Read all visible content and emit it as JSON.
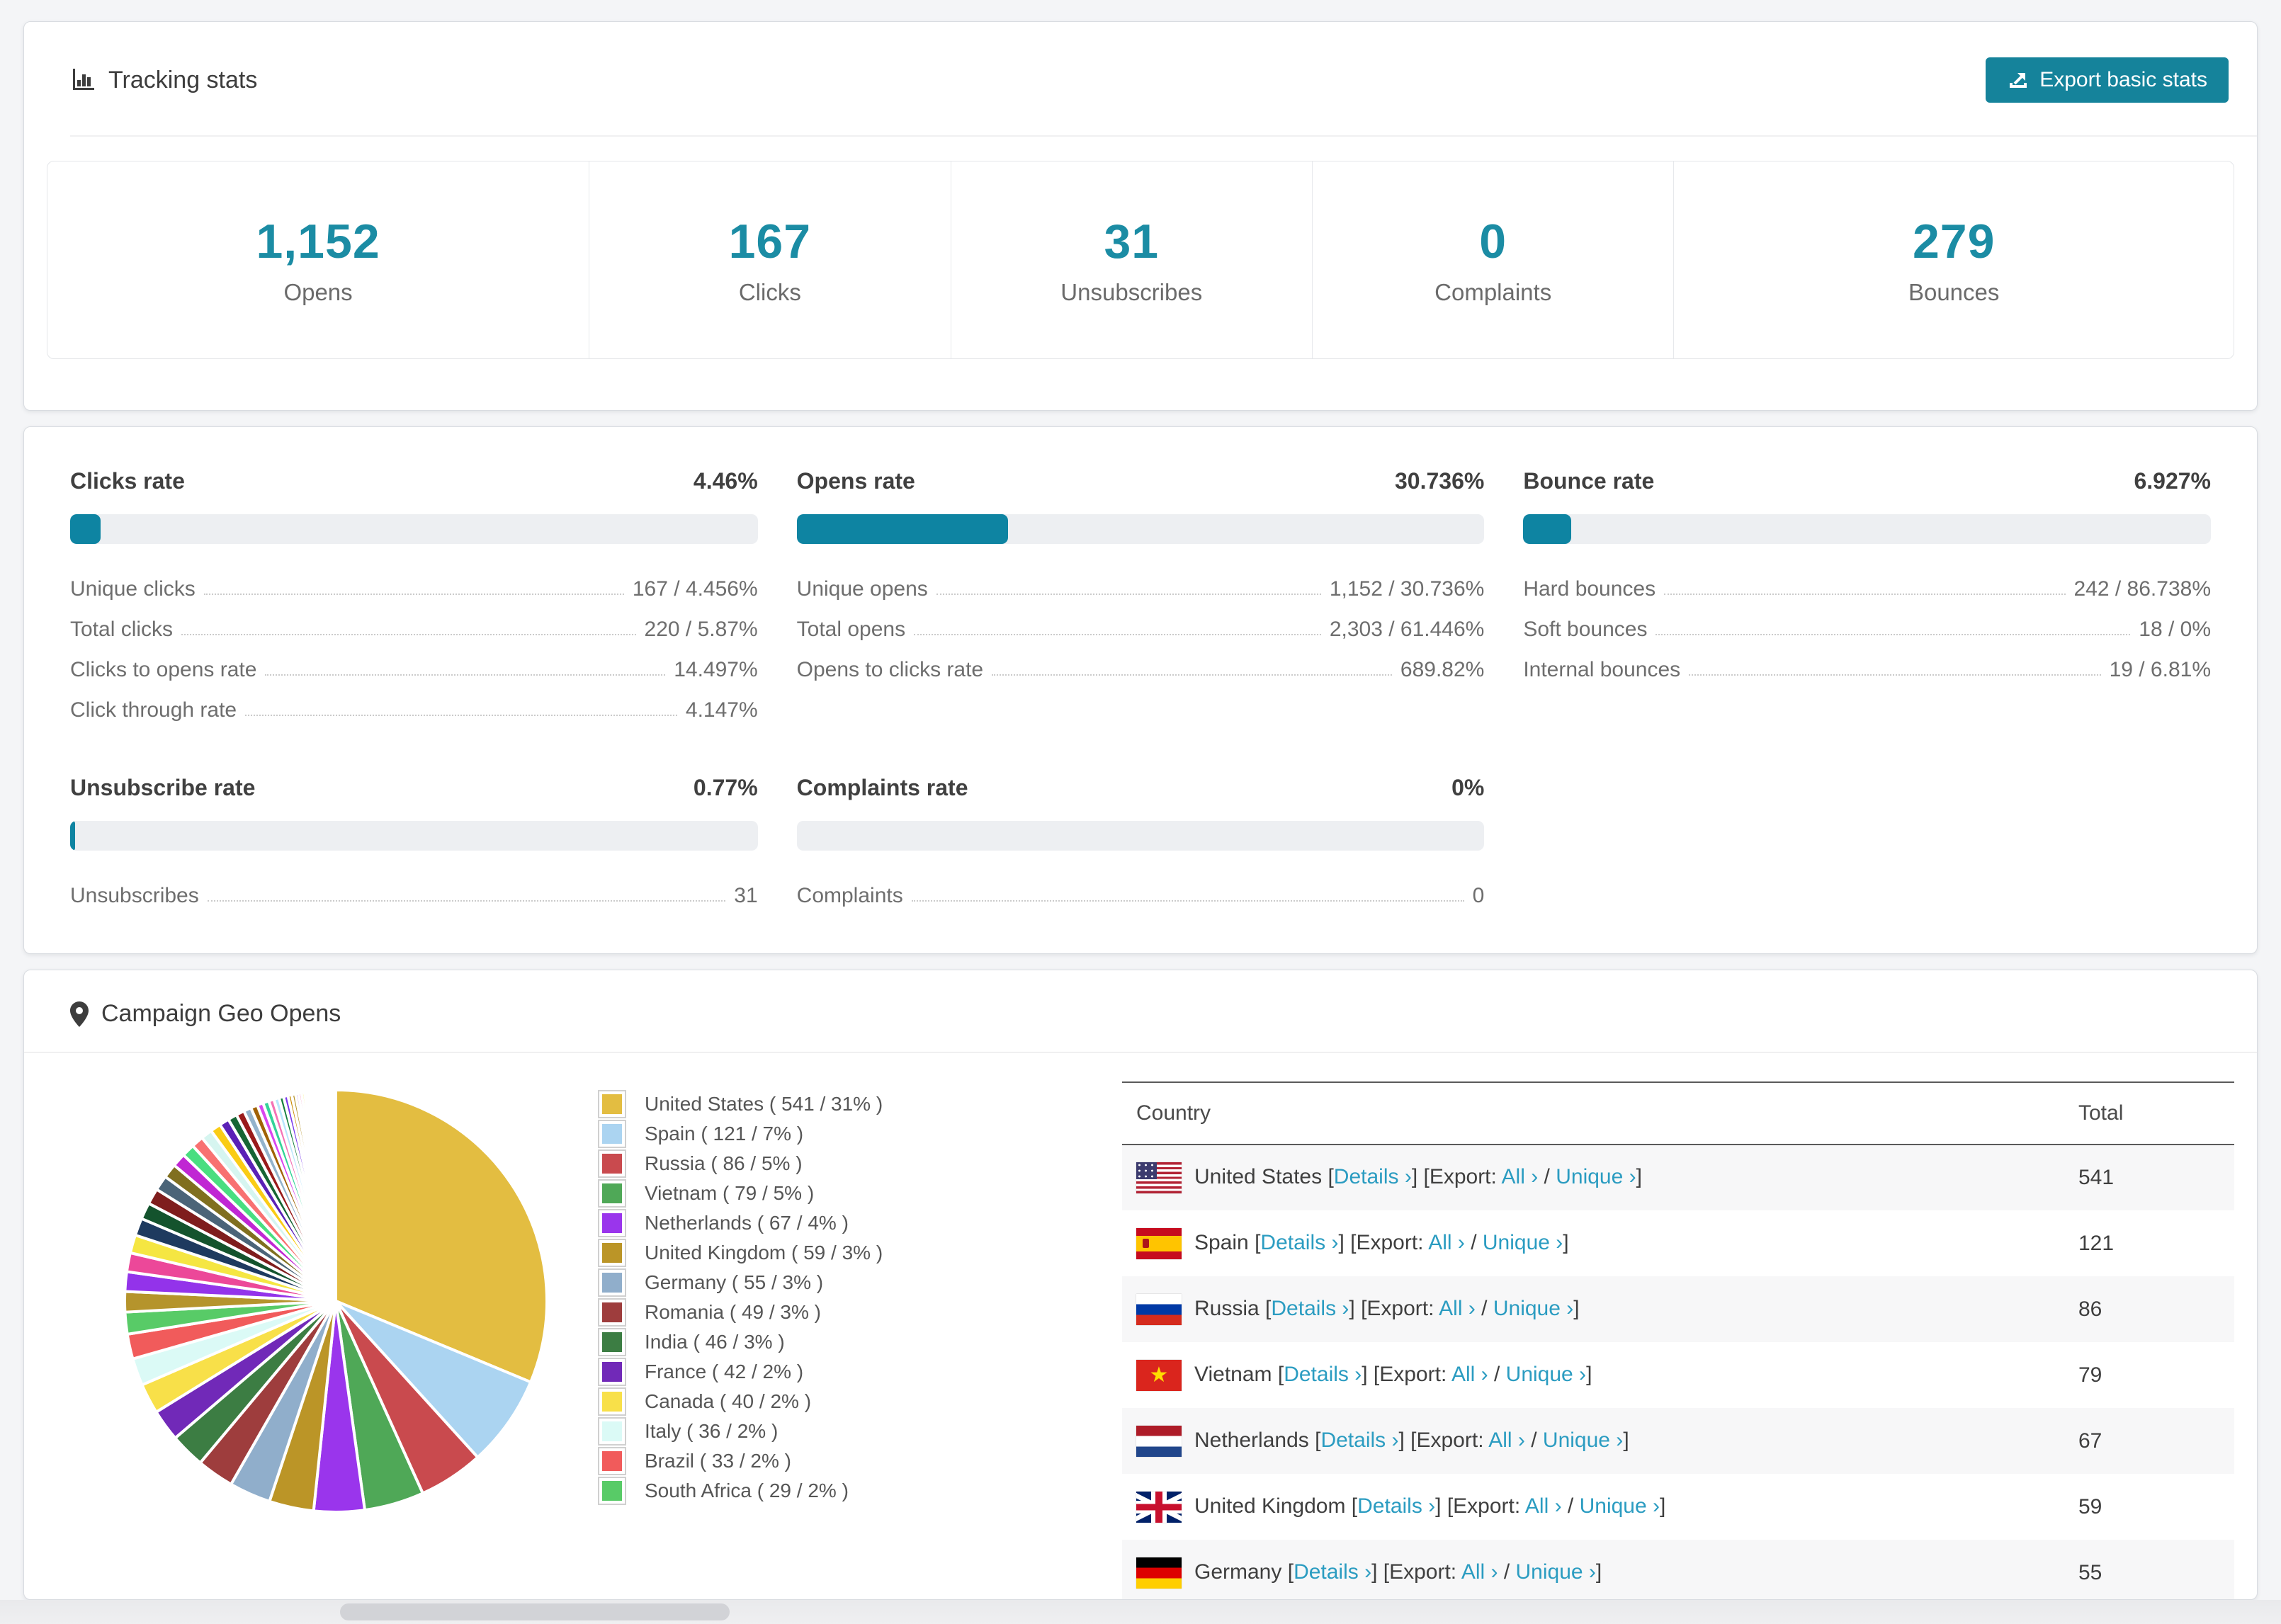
{
  "colors": {
    "accent": "#1b8ca4",
    "accent-dark": "#15839b",
    "link": "#2b9cc1",
    "bar-fill": "#0e84a2",
    "bar-track": "#edeff2",
    "page-bg": "#f4f5f7",
    "card-border": "#d9dce1",
    "row-alt": "#f7f7f8"
  },
  "tracking": {
    "title": "Tracking stats",
    "export_button": "Export basic stats",
    "summary": [
      {
        "value": "1,152",
        "label": "Opens"
      },
      {
        "value": "167",
        "label": "Clicks"
      },
      {
        "value": "31",
        "label": "Unsubscribes"
      },
      {
        "value": "0",
        "label": "Complaints"
      },
      {
        "value": "279",
        "label": "Bounces"
      }
    ]
  },
  "rates": {
    "panels": [
      {
        "title": "Clicks rate",
        "value": "4.46%",
        "percent": 4.46,
        "rows": [
          {
            "label": "Unique clicks",
            "value": "167 / 4.456%"
          },
          {
            "label": "Total clicks",
            "value": "220 / 5.87%"
          },
          {
            "label": "Clicks to opens rate",
            "value": "14.497%"
          },
          {
            "label": "Click through rate",
            "value": "4.147%"
          }
        ]
      },
      {
        "title": "Opens rate",
        "value": "30.736%",
        "percent": 30.736,
        "rows": [
          {
            "label": "Unique opens",
            "value": "1,152 / 30.736%"
          },
          {
            "label": "Total opens",
            "value": "2,303 / 61.446%"
          },
          {
            "label": "Opens to clicks rate",
            "value": "689.82%"
          }
        ]
      },
      {
        "title": "Bounce rate",
        "value": "6.927%",
        "percent": 6.927,
        "rows": [
          {
            "label": "Hard bounces",
            "value": "242 / 86.738%"
          },
          {
            "label": "Soft bounces",
            "value": "18 / 0%"
          },
          {
            "label": "Internal bounces",
            "value": "19 / 6.81%"
          }
        ]
      },
      {
        "title": "Unsubscribe rate",
        "value": "0.77%",
        "percent": 0.77,
        "rows": [
          {
            "label": "Unsubscribes",
            "value": "31"
          }
        ]
      },
      {
        "title": "Complaints rate",
        "value": "0%",
        "percent": 0,
        "rows": [
          {
            "label": "Complaints",
            "value": "0"
          }
        ]
      }
    ]
  },
  "geo": {
    "title": "Campaign Geo Opens",
    "legend_format": "{label} ( {value} / {pct} )",
    "table": {
      "headers": [
        "Country",
        "Total"
      ],
      "links": {
        "details": "Details ›",
        "all": "All ›",
        "unique": "Unique ›",
        "export_prefix": "[Export:",
        "bracket_open": "[",
        "bracket_close": "]",
        "slash": "/"
      },
      "rows": [
        {
          "country": "United States",
          "flag": "us",
          "total": "541"
        },
        {
          "country": "Spain",
          "flag": "es",
          "total": "121"
        },
        {
          "country": "Russia",
          "flag": "ru",
          "total": "86"
        },
        {
          "country": "Vietnam",
          "flag": "vn",
          "total": "79"
        },
        {
          "country": "Netherlands",
          "flag": "nl",
          "total": "67"
        },
        {
          "country": "United Kingdom",
          "flag": "gb",
          "total": "59"
        },
        {
          "country": "Germany",
          "flag": "de",
          "total": "55"
        }
      ]
    }
  },
  "chart_data": {
    "type": "pie",
    "title": "Campaign Geo Opens",
    "legend_position": "right",
    "start_angle_deg": -90,
    "direction": "clockwise",
    "series": [
      {
        "label": "United States",
        "value": 541,
        "pct": "31%",
        "color": "#e3bd41"
      },
      {
        "label": "Spain",
        "value": 121,
        "pct": "7%",
        "color": "#abd4f1"
      },
      {
        "label": "Russia",
        "value": 86,
        "pct": "5%",
        "color": "#c94a4e"
      },
      {
        "label": "Vietnam",
        "value": 79,
        "pct": "5%",
        "color": "#4fa857"
      },
      {
        "label": "Netherlands",
        "value": 67,
        "pct": "4%",
        "color": "#9a35ec"
      },
      {
        "label": "United Kingdom",
        "value": 59,
        "pct": "3%",
        "color": "#bb9527"
      },
      {
        "label": "Germany",
        "value": 55,
        "pct": "3%",
        "color": "#90aecb"
      },
      {
        "label": "Romania",
        "value": 49,
        "pct": "3%",
        "color": "#9e3d3d"
      },
      {
        "label": "India",
        "value": 46,
        "pct": "3%",
        "color": "#3c7d43"
      },
      {
        "label": "France",
        "value": 42,
        "pct": "2%",
        "color": "#7129b8"
      },
      {
        "label": "Canada",
        "value": 40,
        "pct": "2%",
        "color": "#f8e049"
      },
      {
        "label": "Italy",
        "value": 36,
        "pct": "2%",
        "color": "#dbfaf6"
      },
      {
        "label": "Brazil",
        "value": 33,
        "pct": "2%",
        "color": "#f15b5b"
      },
      {
        "label": "South Africa",
        "value": 29,
        "pct": "2%",
        "color": "#58cb67"
      }
    ],
    "unlabeled_tail": {
      "values": [
        27,
        26,
        25,
        24,
        23,
        22,
        21,
        20,
        19,
        18,
        17,
        16,
        15,
        14,
        13,
        12,
        11,
        10,
        9,
        8,
        8,
        7,
        7,
        6,
        6,
        5,
        5,
        4,
        4,
        4,
        3,
        3,
        3,
        2,
        2,
        2,
        2,
        2,
        1,
        1,
        1,
        1,
        1,
        1,
        1,
        1,
        1,
        1,
        1,
        1,
        1,
        1,
        1,
        1,
        1,
        1,
        1,
        1,
        1,
        1
      ],
      "palette": [
        "#b5942c",
        "#9333ea",
        "#ec4899",
        "#f5e642",
        "#1e3a5f",
        "#14532d",
        "#7f1d1d",
        "#4b6478",
        "#806f1f",
        "#c026d3",
        "#4ade80",
        "#f87171",
        "#d6f5f0",
        "#facc15",
        "#5b21b6",
        "#166534",
        "#991b1b",
        "#93b3cc",
        "#a16207",
        "#d946ef",
        "#34d399",
        "#f472b6",
        "#bae6fd",
        "#15803d",
        "#7c3aed",
        "#ca8a04"
      ]
    }
  }
}
